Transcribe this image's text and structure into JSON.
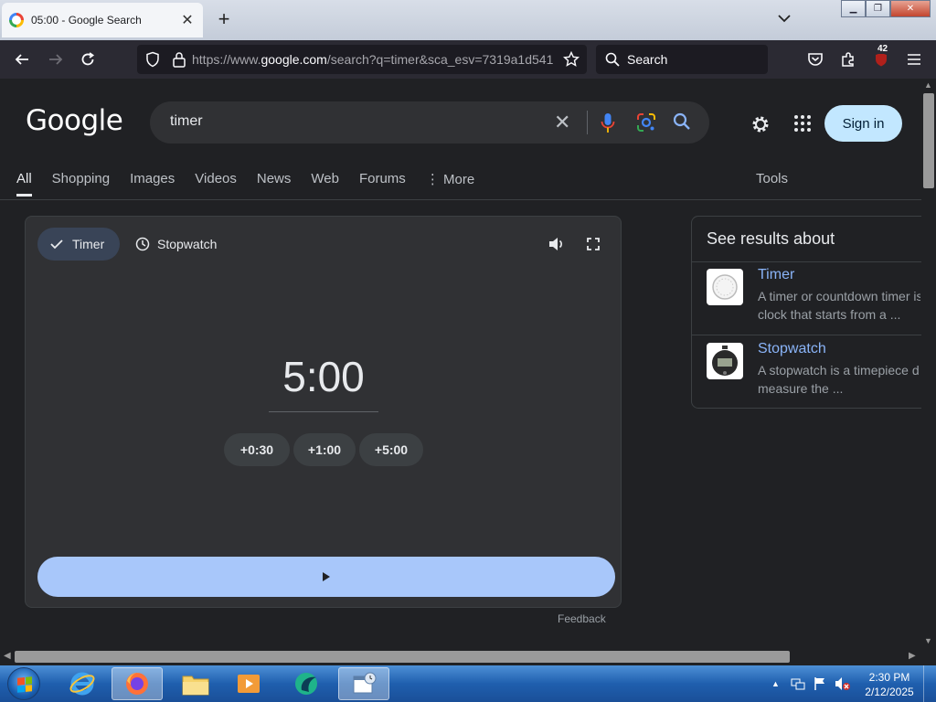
{
  "browser": {
    "tab_title": "05:00 - Google Search",
    "url_prefix": "https://www.",
    "url_domain": "google.com",
    "url_rest": "/search?q=timer&sca_esv=7319a1d541",
    "search_placeholder": "Search",
    "extension_badge": "42"
  },
  "google": {
    "logo": "Google",
    "query": "timer",
    "sign_in": "Sign in",
    "tabs": [
      "All",
      "Shopping",
      "Images",
      "Videos",
      "News",
      "Web",
      "Forums",
      "More"
    ],
    "tools": "Tools"
  },
  "timer_widget": {
    "mode_timer": "Timer",
    "mode_stopwatch": "Stopwatch",
    "time": "5:00",
    "add_buttons": [
      "+0:30",
      "+1:00",
      "+5:00"
    ],
    "feedback": "Feedback"
  },
  "side_panel": {
    "heading": "See results about",
    "results": [
      {
        "title": "Timer",
        "line1": "A timer or countdown timer is",
        "line2": "clock that starts from a ..."
      },
      {
        "title": "Stopwatch",
        "line1": "A stopwatch is a timepiece d",
        "line2": "measure the ..."
      }
    ]
  },
  "taskbar": {
    "time": "2:30 PM",
    "date": "2/12/2025"
  },
  "colors": {
    "page_bg": "#202124",
    "card_bg": "#303134",
    "accent_blue": "#a8c7fa",
    "link_blue": "#8ab4f8",
    "sign_in_bg": "#c2e7ff"
  }
}
